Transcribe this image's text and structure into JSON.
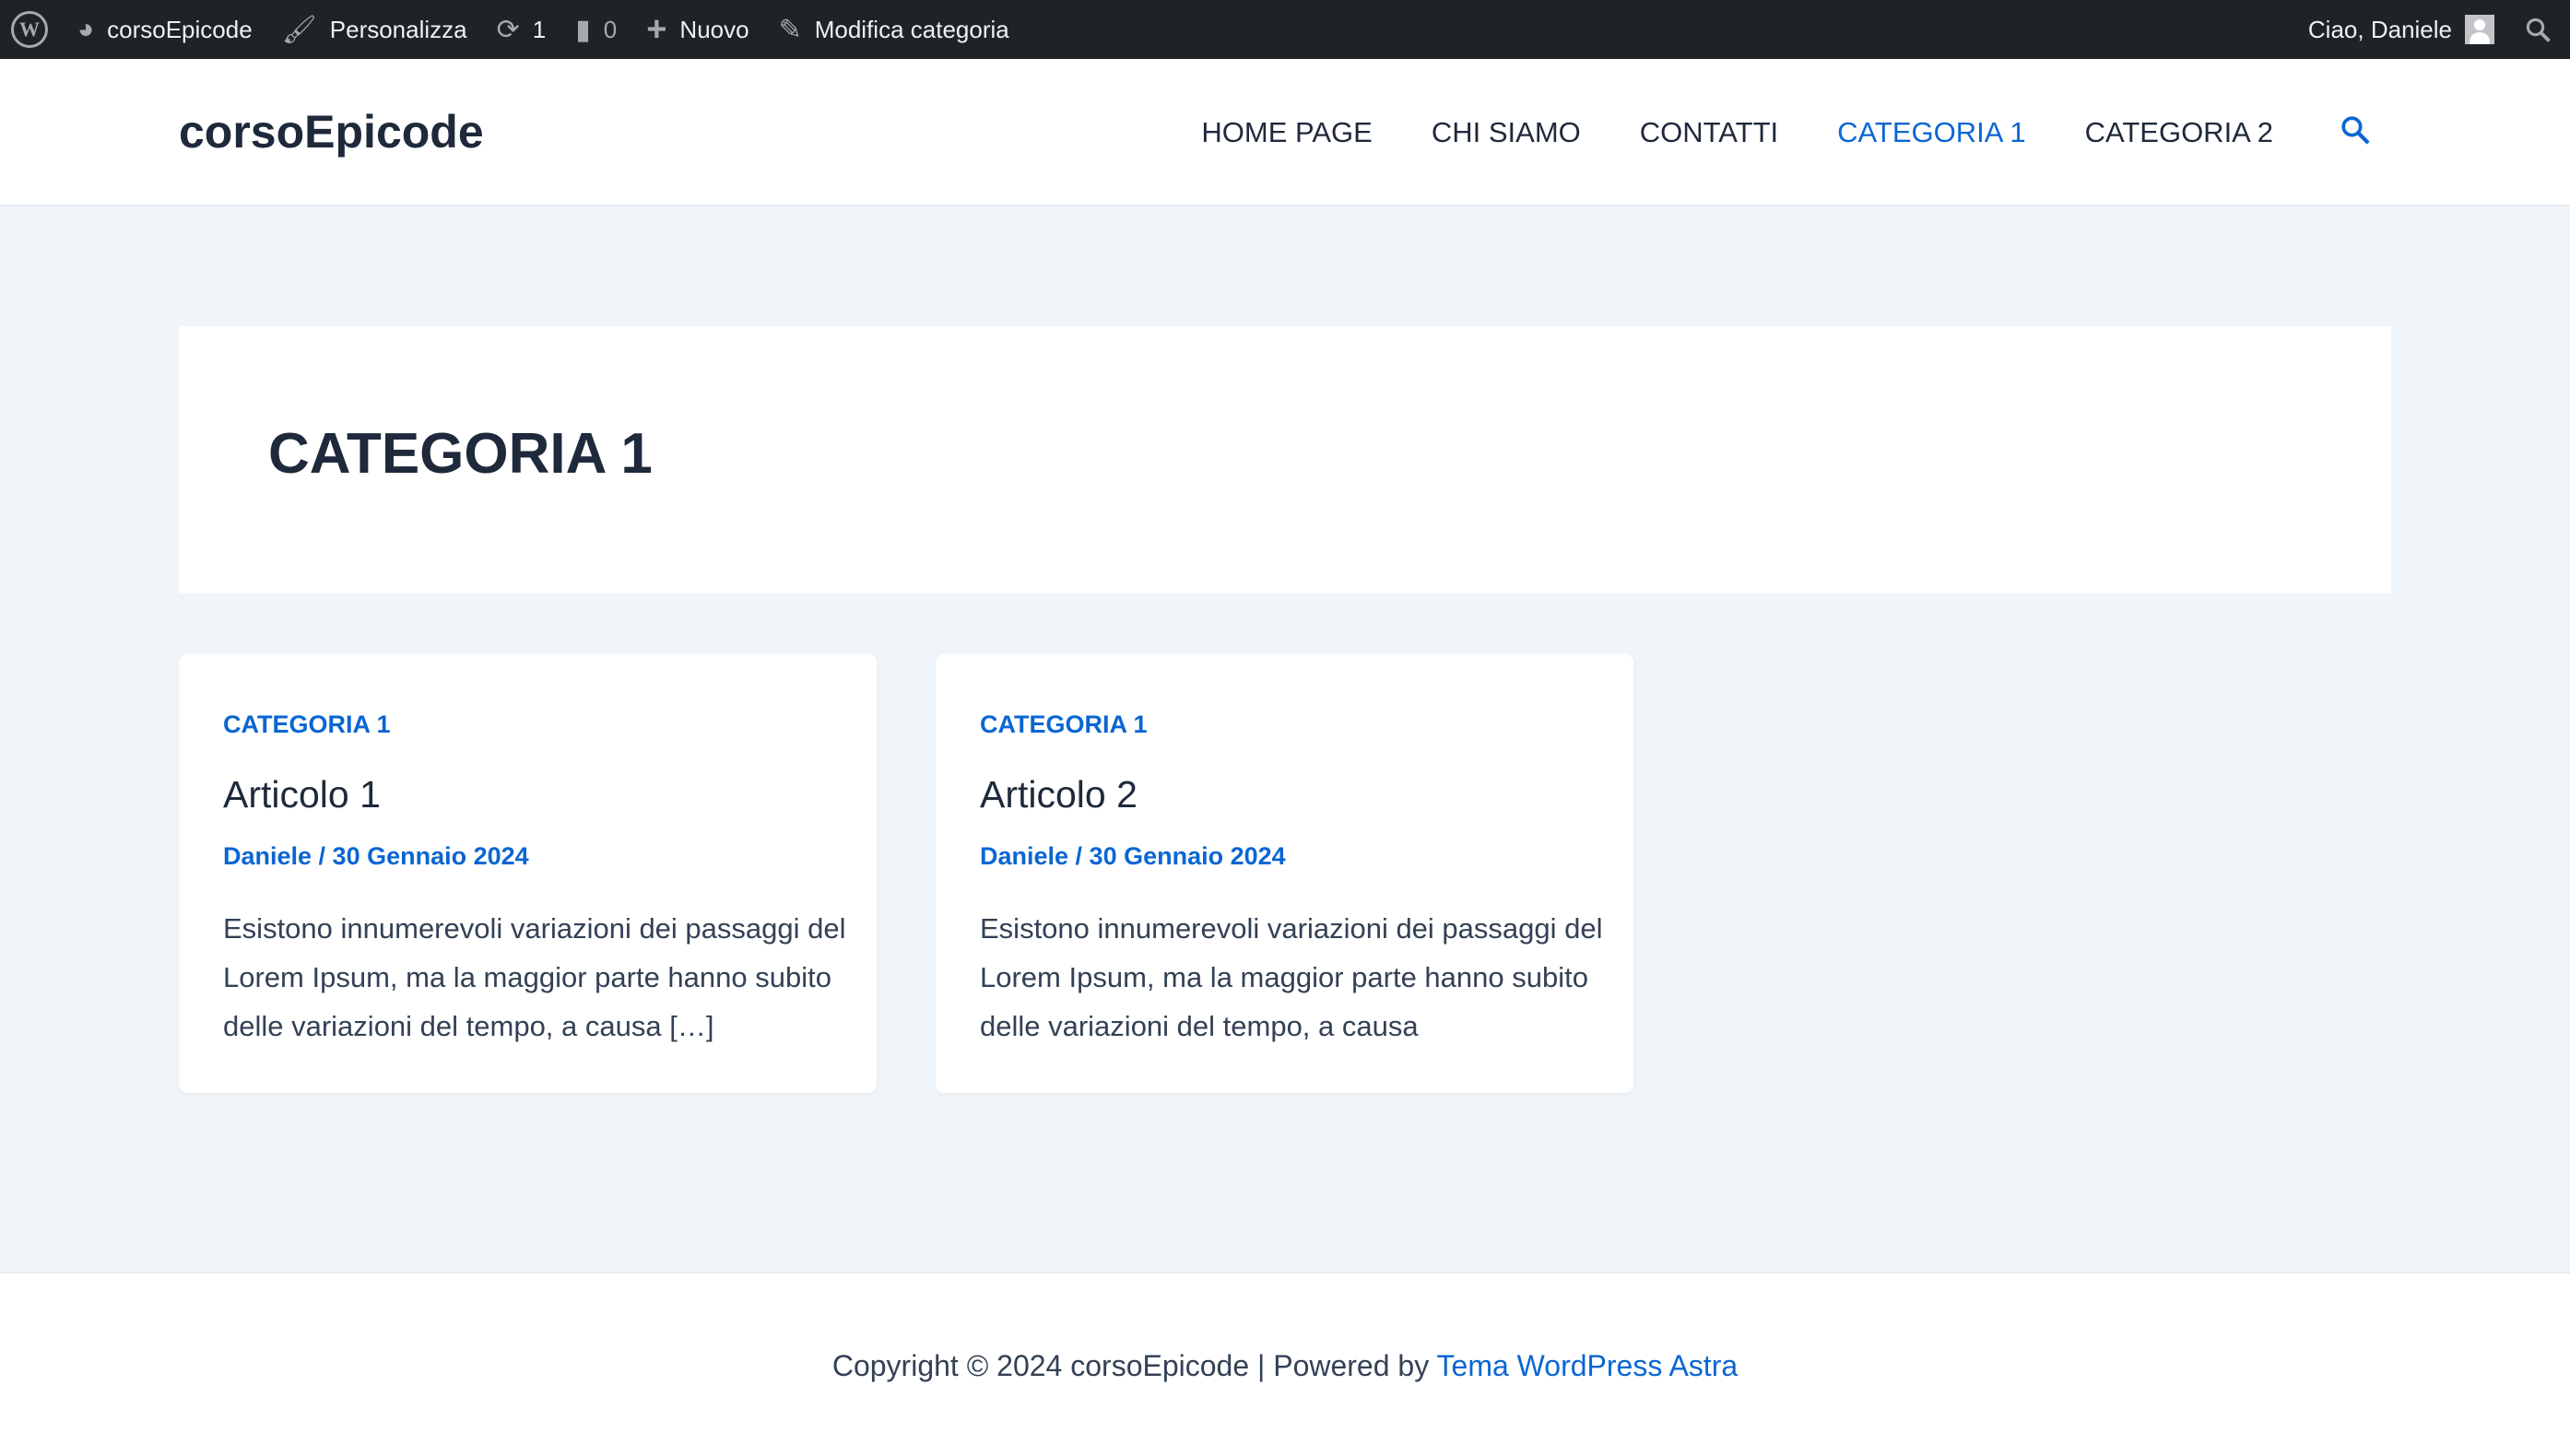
{
  "adminbar": {
    "site": "corsoEpicode",
    "customize": "Personalizza",
    "updates": "1",
    "comments": "0",
    "new": "Nuovo",
    "edit": "Modifica categoria",
    "greeting": "Ciao, Daniele"
  },
  "header": {
    "logo": "corsoEpicode",
    "nav": [
      "HOME PAGE",
      "CHI SIAMO",
      "CONTATTI",
      "CATEGORIA 1",
      "CATEGORIA 2"
    ],
    "active_color": "#0a66d2"
  },
  "archive": {
    "title": "CATEGORIA 1"
  },
  "posts": [
    {
      "category": "CATEGORIA 1",
      "title": "Articolo 1",
      "meta": "Daniele / 30 Gennaio 2024",
      "excerpt": "Esistono innumerevoli variazioni dei passaggi del Lorem Ipsum, ma la maggior parte hanno subito delle variazioni del tempo, a causa […]"
    },
    {
      "category": "CATEGORIA 1",
      "title": "Articolo 2",
      "meta": "Daniele / 30 Gennaio 2024",
      "excerpt": "Esistono innumerevoli variazioni dei passaggi del Lorem Ipsum, ma la maggior parte hanno subito delle variazioni del tempo, a causa"
    }
  ],
  "footer": {
    "text": "Copyright © 2024 corsoEpicode | Powered by ",
    "link": "Tema WordPress Astra"
  }
}
